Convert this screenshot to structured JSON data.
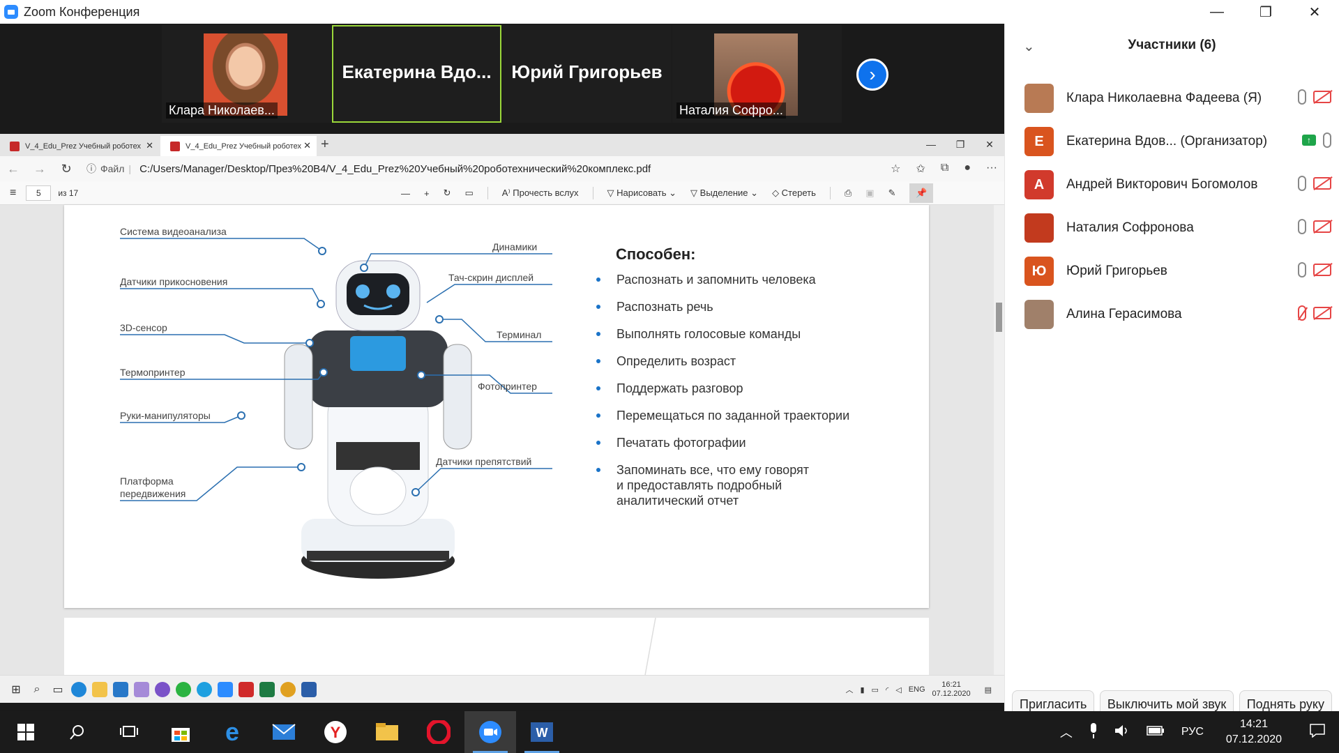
{
  "zoom": {
    "title": "Zoom Конференция",
    "window_buttons": [
      "—",
      "❐",
      "✕"
    ]
  },
  "video_strip": {
    "tiles": [
      {
        "caption": "Клара Николаев..."
      },
      {
        "name": "Екатерина  Вдо..."
      },
      {
        "name": "Юрий Григорьев"
      },
      {
        "caption": "Наталия Софро..."
      }
    ],
    "next_button": "›"
  },
  "participants": {
    "title": "Участники (6)",
    "collapse": "⌄",
    "list": [
      {
        "name": "Клара Николаевна Фадеева (Я)",
        "avatar": "",
        "color": "#b87a54"
      },
      {
        "name": "Екатерина Вдов...   (Организатор)",
        "avatar": "Е",
        "color": "#d9541e"
      },
      {
        "name": "Андрей Викторович Богомолов",
        "avatar": "А",
        "color": "#d13a2c"
      },
      {
        "name": "Наталия Софронова",
        "avatar": "",
        "color": "#c23a1e"
      },
      {
        "name": "Юрий Григорьев",
        "avatar": "Ю",
        "color": "#d9541e"
      },
      {
        "name": "Алина Герасимова",
        "avatar": "",
        "color": "#a0806a"
      }
    ],
    "buttons": {
      "invite": "Пригласить",
      "mute": "Выключить мой звук",
      "raise_hand": "Поднять руку"
    }
  },
  "browser": {
    "tabs": [
      {
        "title": "V_4_Edu_Prez Учебный роботех"
      },
      {
        "title": "V_4_Edu_Prez Учебный роботех"
      }
    ],
    "address": {
      "scheme_label": "Файл",
      "url": "C:/Users/Manager/Desktop/През%20В4/V_4_Edu_Prez%20Учебный%20роботехнический%20комплекс.pdf"
    },
    "pdf_toolbar": {
      "page": "5",
      "of_pages": "из 17",
      "read_aloud": "Прочесть вслух",
      "draw": "Нарисовать",
      "highlight": "Выделение",
      "erase": "Стереть"
    }
  },
  "slide": {
    "labels_left": [
      "Система видеоанализа",
      "Датчики прикосновения",
      "3D-сенсор",
      "Термопринтер",
      "Руки-манипуляторы",
      "Платформа",
      "передвижения"
    ],
    "labels_right": [
      "Динамики",
      "Тач-скрин дисплей",
      "Терминал",
      "Фотопринтер",
      "Датчики препятствий"
    ],
    "capable_title": "Способен:",
    "bullets": [
      "Распознать и запомнить человека",
      "Распознать речь",
      "Выполнять голосовые команды",
      "Определить возраст",
      "Поддержать разговор",
      "Перемещаться по заданной траектории",
      "Печатать фотографии",
      "Запоминать все, что ему говорят"
    ],
    "bullet_last_line2": "и предоставлять подробный",
    "bullet_last_line3": "аналитический отчет"
  },
  "inner_taskbar": {
    "lang": "ENG",
    "time": "16:21",
    "date": "07.12.2020"
  },
  "taskbar": {
    "lang": "РУС",
    "time": "14:21",
    "date": "07.12.2020"
  }
}
